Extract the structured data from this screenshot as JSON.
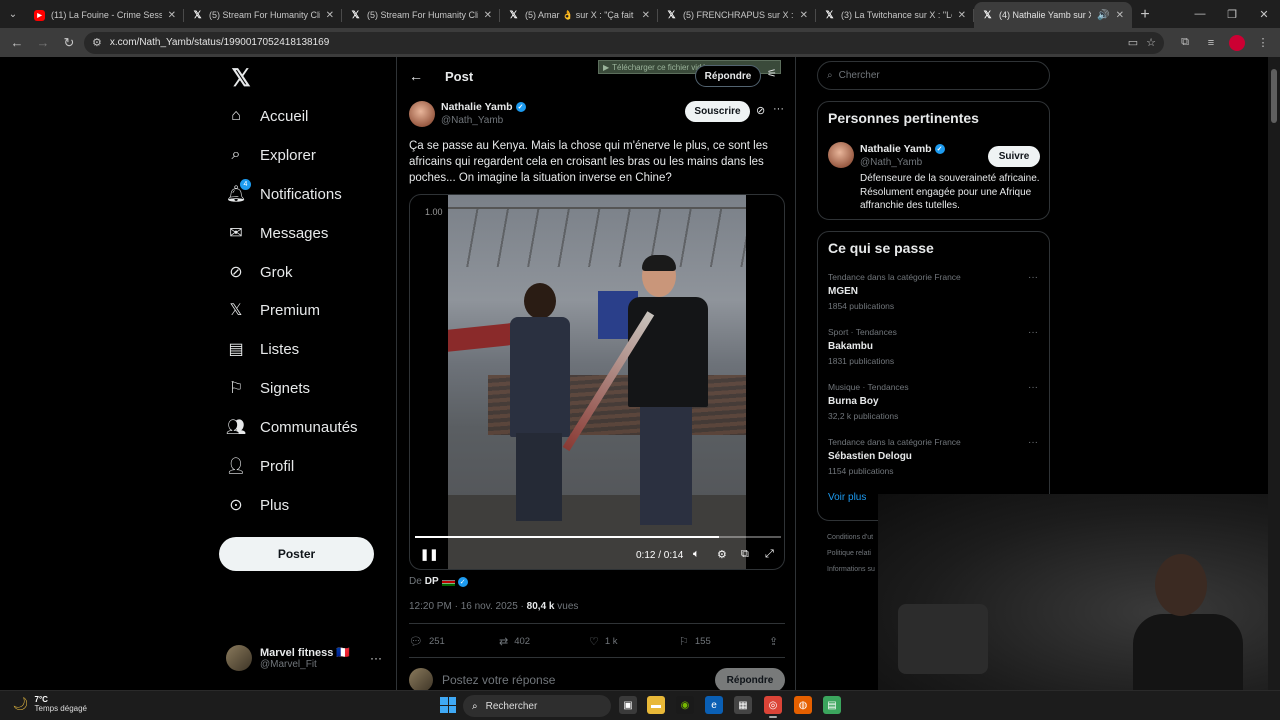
{
  "browser": {
    "tabs": [
      {
        "title": "(11) La Fouine - Crime Session",
        "favicon": "youtube-icon",
        "active": false
      },
      {
        "title": "(5) Stream For Humanity Clips",
        "favicon": "x-icon",
        "active": false
      },
      {
        "title": "(5) Stream For Humanity Clips",
        "favicon": "x-icon",
        "active": false
      },
      {
        "title": "(5) Amar 👌 sur X : \"Ça fait des",
        "favicon": "x-icon",
        "active": false
      },
      {
        "title": "(5) FRENCHRAPUS sur X : \"🎨",
        "favicon": "x-icon",
        "active": false
      },
      {
        "title": "(3) La Twitchance sur X : \"Le fai",
        "favicon": "x-icon",
        "active": false
      },
      {
        "title": "(4) Nathalie Yamb sur X : \"Ç",
        "favicon": "x-icon",
        "active": true
      }
    ],
    "url": "x.com/Nath_Yamb/status/1990017052418138169"
  },
  "nav": {
    "items": [
      {
        "label": "Accueil",
        "icon": "home-icon"
      },
      {
        "label": "Explorer",
        "icon": "search-icon"
      },
      {
        "label": "Notifications",
        "icon": "bell-icon",
        "badge": "4"
      },
      {
        "label": "Messages",
        "icon": "envelope-icon"
      },
      {
        "label": "Grok",
        "icon": "grok-icon"
      },
      {
        "label": "Premium",
        "icon": "x-logo-icon"
      },
      {
        "label": "Listes",
        "icon": "list-icon"
      },
      {
        "label": "Signets",
        "icon": "bookmark-icon"
      },
      {
        "label": "Communautés",
        "icon": "people-icon"
      },
      {
        "label": "Profil",
        "icon": "person-icon"
      },
      {
        "label": "Plus",
        "icon": "more-circle-icon"
      }
    ],
    "post_button": "Poster",
    "account": {
      "name": "Marvel fitness 🇫🇷",
      "handle": "@Marvel_Fit"
    }
  },
  "post": {
    "header_title": "Post",
    "download_overlay": "Télécharger ce fichier vidéo",
    "reply_top": "Répondre",
    "author": {
      "name": "Nathalie Yamb",
      "handle": "@Nath_Yamb"
    },
    "subscribe": "Souscrire",
    "text": "Ça se passe au Kenya. Mais la chose qui m'énerve le plus, ce sont les africains qui regardent cela en croisant les bras ou les mains dans les poches...  On imagine la situation inverse en Chine?",
    "video": {
      "speed": "1.00",
      "time": "0:12 / 0:14",
      "progress": 0.83
    },
    "from_label": "De",
    "from_name": "DP",
    "timestamp": "12:20 PM · 16 nov. 2025 · ",
    "views_count": "80,4 k",
    "views_label": " vues",
    "stats": {
      "replies": "251",
      "reposts": "402",
      "likes": "1 k",
      "bookmarks": "155"
    },
    "reply_placeholder": "Postez votre réponse",
    "reply_button": "Répondre"
  },
  "sidebar": {
    "search_placeholder": "Chercher",
    "relevant_title": "Personnes pertinentes",
    "relevant_person": {
      "name": "Nathalie Yamb",
      "handle": "@Nath_Yamb",
      "follow": "Suivre",
      "bio": "Défenseure de la souveraineté africaine. Résolument engagée pour une Afrique affranchie des tutelles."
    },
    "trends_title": "Ce qui se passe",
    "trends": [
      {
        "context": "Tendance dans la catégorie France",
        "name": "MGEN",
        "count": "1854 publications"
      },
      {
        "context": "Sport · Tendances",
        "name": "Bakambu",
        "count": "1831 publications"
      },
      {
        "context": "Musique · Tendances",
        "name": "Burna Boy",
        "count": "32,2 k publications"
      },
      {
        "context": "Tendance dans la catégorie France",
        "name": "Sébastien Delogu",
        "count": "1154 publications"
      }
    ],
    "see_more": "Voir plus",
    "footer_links": [
      "Conditions d'ut",
      "Politique relati",
      "Informations su"
    ]
  },
  "taskbar": {
    "temperature": "7°C",
    "weather": "Temps dégagé",
    "search_label": "Rechercher"
  }
}
